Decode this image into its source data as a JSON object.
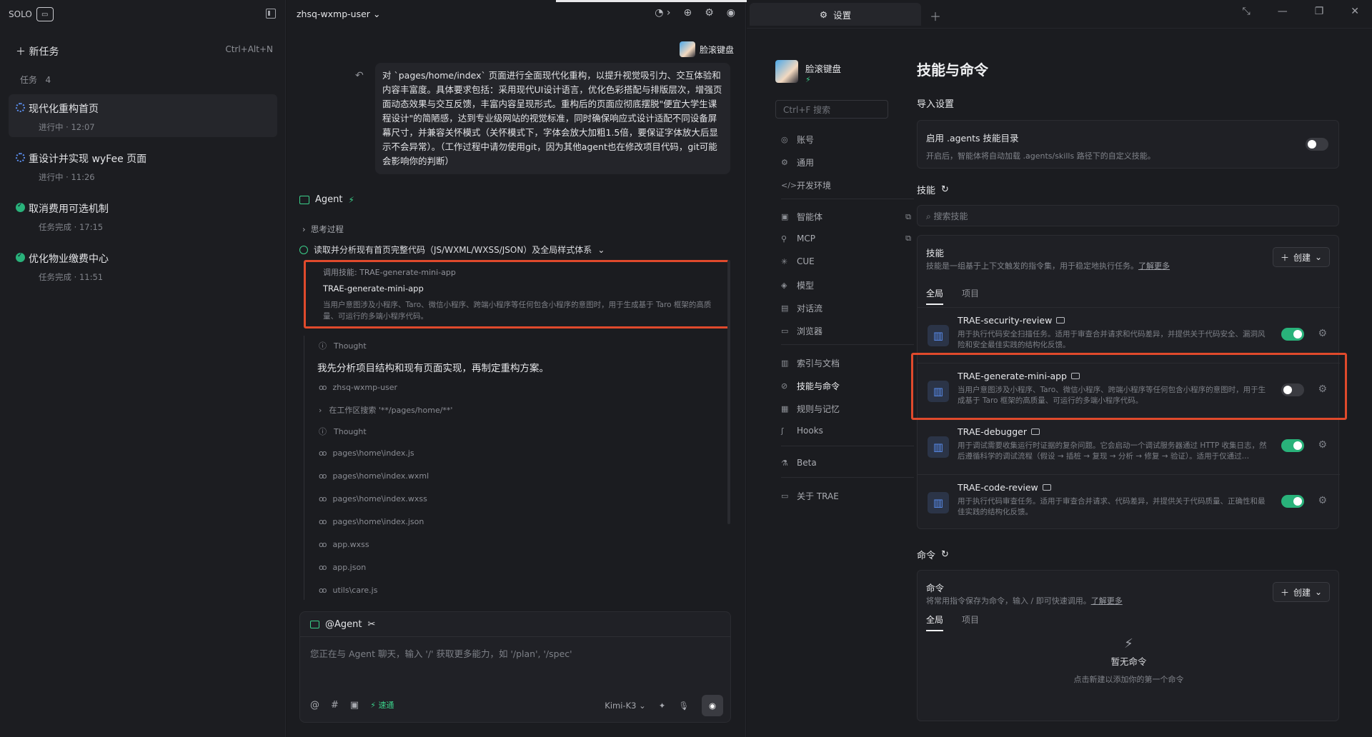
{
  "sidebar": {
    "brand": "SOLO",
    "new_task": "新任务",
    "new_task_shortcut": "Ctrl+Alt+N",
    "tasks_label": "任务",
    "tasks_count": "4",
    "tasks": [
      {
        "title": "现代化重构首页",
        "status": "进行中 · 12:07"
      },
      {
        "title": "重设计并实现 wyFee 页面",
        "status": "进行中 · 11:26"
      },
      {
        "title": "取消费用可选机制",
        "status": "任务完成 · 17:15"
      },
      {
        "title": "优化物业缴费中心",
        "status": "任务完成 · 11:51"
      }
    ]
  },
  "chat": {
    "project": "zhsq-wxmp-user",
    "user_name": "脸滚键盘",
    "prompt": "对 `pages/home/index` 页面进行全面现代化重构，以提升视觉吸引力、交互体验和内容丰富度。具体要求包括：采用现代UI设计语言，优化色彩搭配与排版层次，增强页面动态效果与交互反馈，丰富内容呈现形式。重构后的页面应彻底摆脱\"便宜大学生课程设计\"的简陋感，达到专业级网站的视觉标准，同时确保响应式设计适配不同设备屏幕尺寸，并兼容关怀模式（关怀模式下，字体会放大加粗1.5倍，要保证字体放大后显示不会异常）。（工作过程中请勿使用git，因为其他agent也在修改项目代码，git可能会影响你的判断）",
    "agent_label": "Agent",
    "thinking": "思考过程",
    "read_step": "读取并分析现有首页完整代码（JS/WXML/WXSS/JSON）及全局样式体系",
    "skill_call": "调用技能: TRAE-generate-mini-app",
    "skill_name": "TRAE-generate-mini-app",
    "skill_desc": "当用户意图涉及小程序、Taro、微信小程序、跨端小程序等任何包含小程序的意图时，用于生成基于 Taro 框架的高质量、可运行的多端小程序代码。",
    "thought1": "Thought",
    "analysis": "我先分析项目结构和现有页面实现，再制定重构方案。",
    "files": [
      "zhsq-wxmp-user",
      "在工作区搜索 '**/pages/home/**'",
      "Thought",
      "pages\\home\\index.js",
      "pages\\home\\index.wxml",
      "pages\\home\\index.wxss",
      "pages\\home\\index.json",
      "app.wxss",
      "app.json",
      "utils\\care.js"
    ],
    "composer_title": "@Agent",
    "composer_placeholder": "您正在与 Agent 聊天，输入 '/' 获取更多能力，如 '/plan', '/spec'",
    "speed": "速通",
    "model": "Kimi-K3"
  },
  "settings": {
    "tab_title": "设置",
    "profile_name": "脸滚键盘",
    "search_placeholder": "Ctrl+F 搜索",
    "nav": [
      "账号",
      "通用",
      "开发环境",
      "智能体",
      "MCP",
      "CUE",
      "模型",
      "对话流",
      "浏览器",
      "索引与文档",
      "技能与命令",
      "规则与记忆",
      "Hooks",
      "Beta",
      "关于 TRAE"
    ],
    "page_title": "技能与命令",
    "import_title": "导入设置",
    "agents_dir_title": "启用 .agents 技能目录",
    "agents_dir_desc": "开启后，智能体将自动加载 .agents/skills 路径下的自定义技能。",
    "skills_title": "技能",
    "skills_search": "搜索技能",
    "skills_box_title": "技能",
    "skills_box_desc": "技能是一组基于上下文触发的指令集，用于稳定地执行任务。",
    "learn_more": "了解更多",
    "create": "创建",
    "tab_all": "全局",
    "tab_project": "项目",
    "skills": [
      {
        "name": "TRAE-security-review",
        "desc": "用于执行代码安全扫描任务。适用于审查合并请求和代码差异，并提供关于代码安全、漏洞风险和安全最佳实践的结构化反馈。",
        "on": true
      },
      {
        "name": "TRAE-generate-mini-app",
        "desc": "当用户意图涉及小程序、Taro、微信小程序、跨端小程序等任何包含小程序的意图时，用于生成基于 Taro 框架的高质量、可运行的多端小程序代码。",
        "on": false
      },
      {
        "name": "TRAE-debugger",
        "desc": "用于调试需要收集运行时证据的复杂问题。它会启动一个调试服务器通过 HTTP 收集日志，然后遵循科学的调试流程（假设 → 插桩 → 复现 → 分析 → 修复 → 验证）。适用于仅通过…",
        "on": true
      },
      {
        "name": "TRAE-code-review",
        "desc": "用于执行代码审查任务。适用于审查合并请求、代码差异，并提供关于代码质量、正确性和最佳实践的结构化反馈。",
        "on": true
      }
    ],
    "commands_title": "命令",
    "commands_box_title": "命令",
    "commands_box_desc": "将常用指令保存为命令，输入 / 即可快速调用。",
    "empty_title": "暂无命令",
    "empty_desc": "点击新建以添加你的第一个命令"
  }
}
